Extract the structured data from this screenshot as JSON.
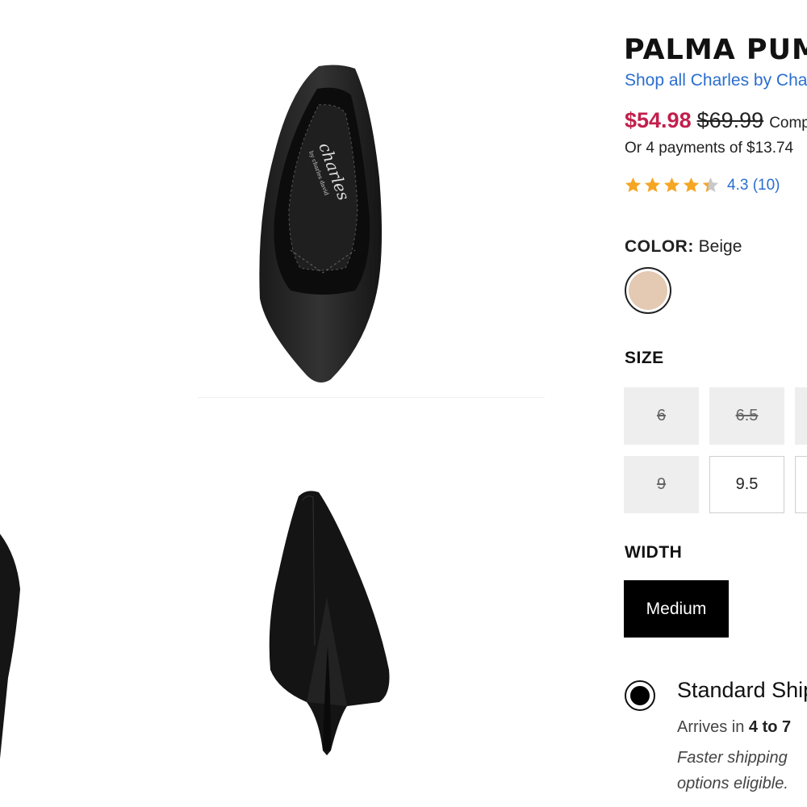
{
  "product": {
    "title": "PALMA PUMP",
    "brand_link": "Shop all Charles by Charles David",
    "sale_price": "$54.98",
    "original_price": "$69.99",
    "compare_label": "Compare",
    "payments": "Or 4 payments of $13.74"
  },
  "rating": {
    "value": 4.3,
    "text": "4.3 (10)"
  },
  "color": {
    "label": "COLOR:",
    "selected": "Beige",
    "swatch_color": "#e4c9b3"
  },
  "size": {
    "label": "SIZE",
    "options": [
      {
        "value": "6",
        "available": false
      },
      {
        "value": "6.5",
        "available": false
      },
      {
        "value": "9",
        "available": false
      },
      {
        "value": "9.5",
        "available": true
      }
    ]
  },
  "width": {
    "label": "WIDTH",
    "selected": "Medium"
  },
  "shipping": {
    "option_title": "Standard Shipping",
    "arrives_prefix": "Arrives in ",
    "arrives_bold": "4 to 7",
    "note": "Faster shipping options eligible."
  },
  "colors": {
    "link": "#2a6ecf",
    "sale": "#c21f4c",
    "star": "#f5a623"
  },
  "insole_logo": "charles by charles david"
}
